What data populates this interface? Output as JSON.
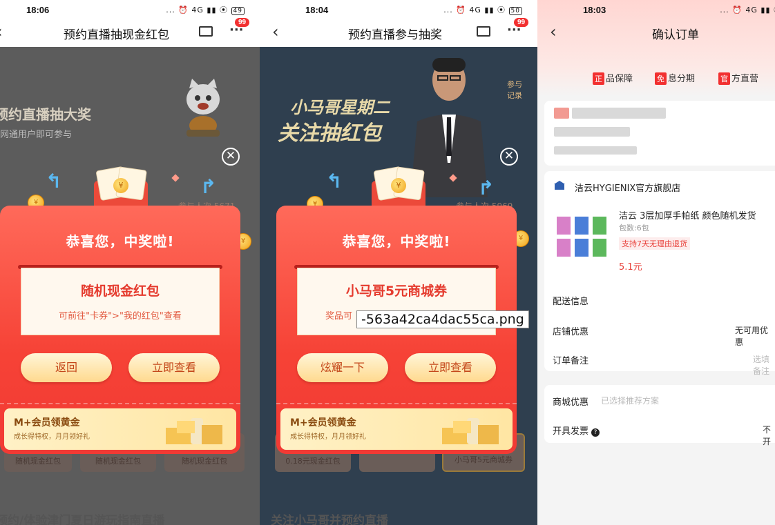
{
  "panel1": {
    "status": {
      "time": "18:06",
      "icons": "... ⏰ 4G ▮▮ ⦿",
      "battery": "49"
    },
    "nav": {
      "back": "‹",
      "title": "预约直播抽现金红包",
      "badge": "99"
    },
    "banner": {
      "title": "预约直播抽大奖",
      "subtitle": "网通用户即可参与",
      "add_label": "添加",
      "participants": "参与人次 5671"
    },
    "modal": {
      "headline": "恭喜您，中奖啦!",
      "prize": "随机现金红包",
      "hint": "可前往\"卡券\">\"我的红包\"查看",
      "back_button": "返回",
      "view_button": "立即查看",
      "vip_title": "M+会员领黄金",
      "vip_sub": "成长得特权，月月领好礼",
      "close": "✕"
    },
    "tiles": [
      "随机现金红包",
      "随机现金红包",
      "随机现金红包"
    ],
    "bottom_title": "预约/体验津门夏日游玩指南直播"
  },
  "panel2": {
    "status": {
      "time": "18:04",
      "icons": "... ⏰ 4G ▮▮ ⦿",
      "battery": "50"
    },
    "nav": {
      "back": "‹",
      "title": "预约直播参与抽奖",
      "badge": "99"
    },
    "banner": {
      "line1": "小马哥星期二",
      "line2": "关注抽红包",
      "participate": "参与记录",
      "add_label": "添加",
      "participants": "参与人次 5969"
    },
    "modal": {
      "headline": "恭喜您，中奖啦!",
      "prize": "小马哥5元商城券",
      "hint": "奖品可",
      "back_button": "炫耀一下",
      "view_button": "立即查看",
      "vip_title": "M+会员领黄金",
      "vip_sub": "成长得特权，月月领好礼",
      "close": "✕"
    },
    "tiles": [
      "0.18元现金红包",
      "",
      "小马哥5元商城券"
    ],
    "bottom_title": "关注小马哥并预约直播"
  },
  "panel3": {
    "status": {
      "time": "18:03",
      "icons": "... ⏰ 4G ▮▮ ⦿"
    },
    "nav": {
      "back": "‹",
      "title": "确认订单"
    },
    "guarantees": [
      {
        "mark": "正",
        "text": "品保障"
      },
      {
        "mark": "免",
        "text": "息分期"
      },
      {
        "mark": "官",
        "text": "方直营"
      }
    ],
    "shop": "洁云HYGIENIX官方旗舰店",
    "product": {
      "title": "洁云 3层加厚手帕纸 颜色随机发货",
      "count": "包数:6包",
      "tag": "支持7天无理由退货",
      "price": "5.1元"
    },
    "rows": {
      "delivery": "配送信息",
      "shop_discount": "店铺优惠",
      "shop_discount_value": "无可用优惠",
      "note": "订单备注",
      "note_placeholder": "选填备注",
      "mall_discount": "商城优惠",
      "mall_discount_sub": "已选择推荐方案",
      "invoice": "开具发票",
      "invoice_value": "不开"
    }
  },
  "filename_label": "-563a42ca4dac55ca.png"
}
